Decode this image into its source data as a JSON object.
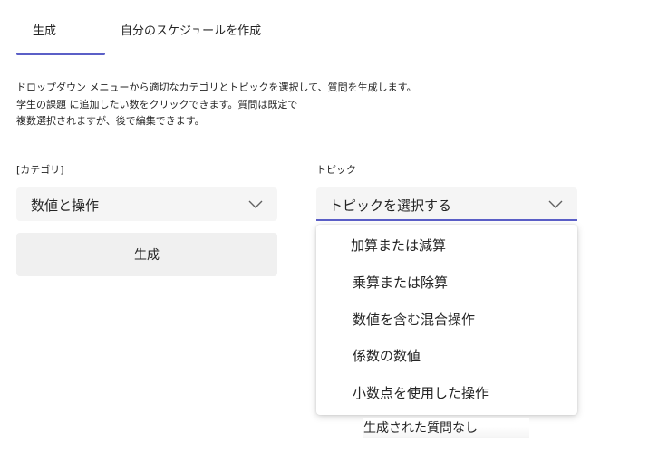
{
  "tabs": [
    {
      "label": "生成",
      "active": true
    },
    {
      "label": "自分のスケジュールを作成",
      "active": false
    }
  ],
  "description": {
    "line1": "ドロップダウン メニューから適切なカテゴリとトピックを選択して、質問を生成します。",
    "line2": "学生の課題 に追加したい数をクリックできます。質問は既定で",
    "line3": "複数選択されますが、後で編集できます。"
  },
  "category": {
    "label": "[カテゴリ]",
    "value": "数値と操作"
  },
  "topic": {
    "label": "トピック",
    "placeholder": "トピックを選択する",
    "options": [
      "加算または減算",
      "乗算または除算",
      "数値を含む混合操作",
      "係数の数値",
      "小数点を使用した操作"
    ]
  },
  "generate_button": {
    "label": "生成"
  },
  "empty_status": "生成された質問なし",
  "colors": {
    "accent": "#5b5fc7",
    "field_background": "#f5f5f5",
    "button_background": "#f0f0f0"
  },
  "icons": {
    "dropdown": "chevron-down-icon"
  }
}
